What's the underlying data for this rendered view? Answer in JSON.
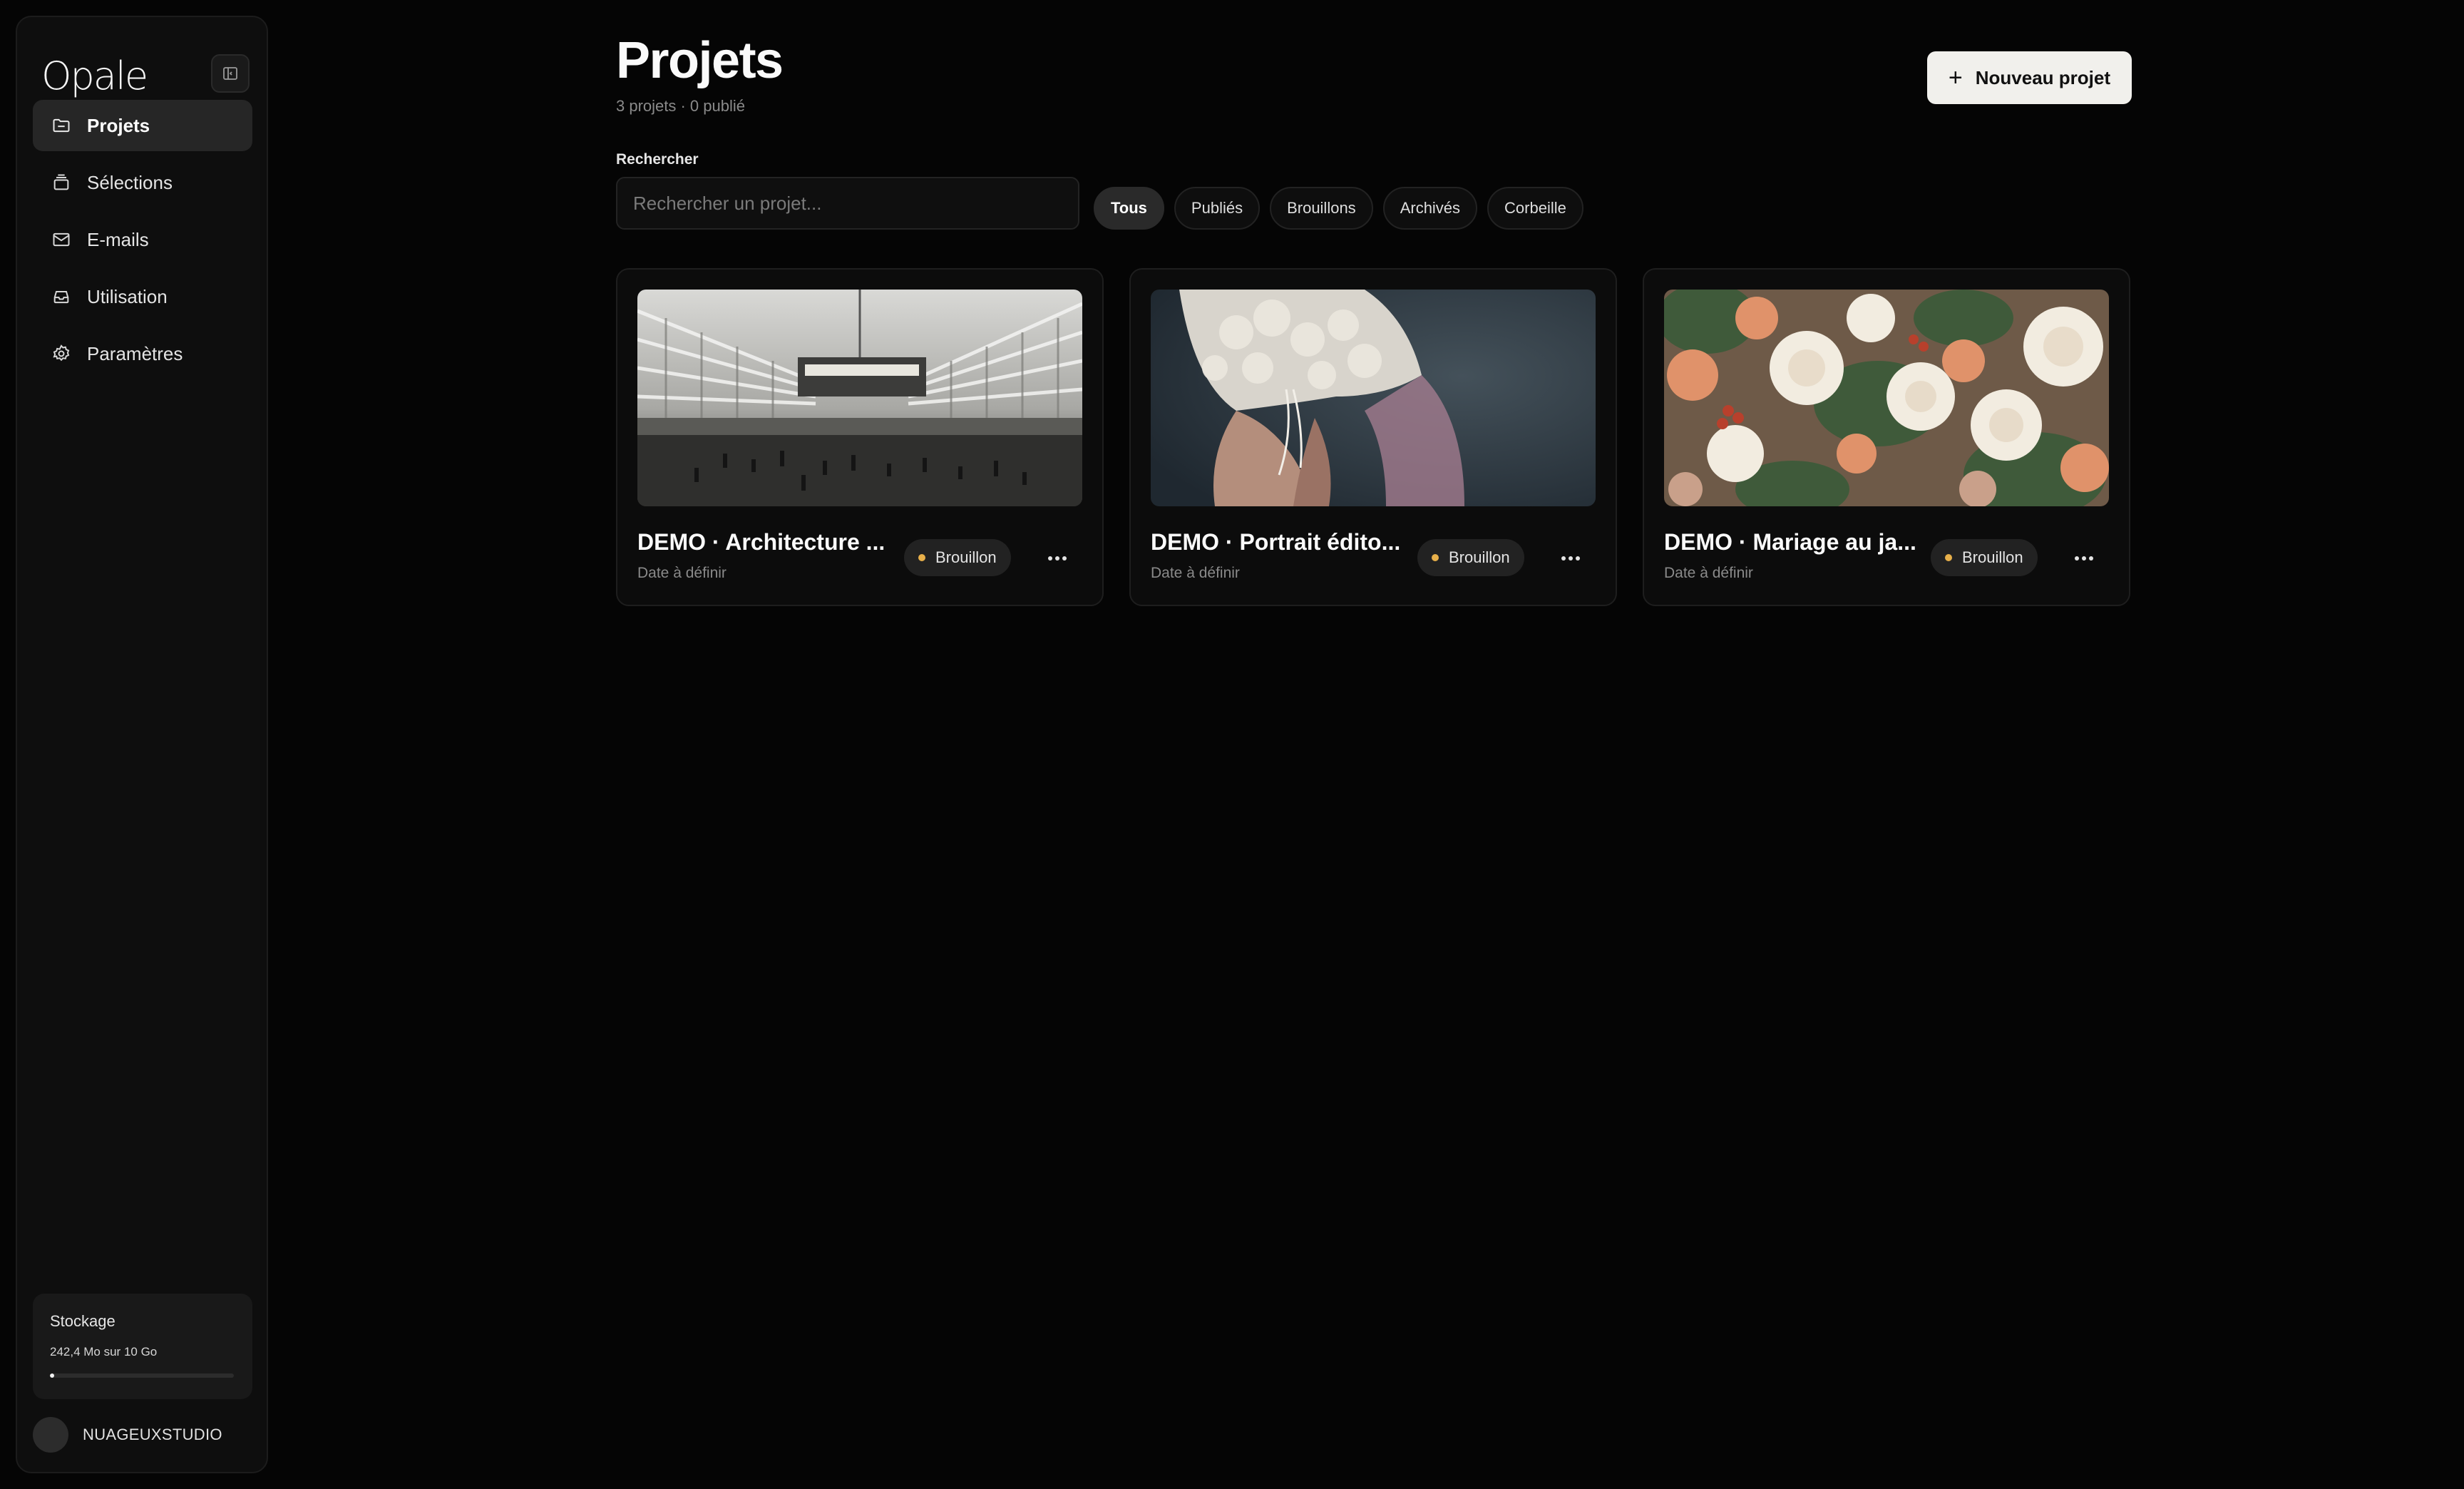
{
  "app": {
    "logo": "Opale"
  },
  "sidebar": {
    "items": [
      {
        "label": "Projets",
        "icon": "folder-icon",
        "active": true
      },
      {
        "label": "Sélections",
        "icon": "layers-icon",
        "active": false
      },
      {
        "label": "E-mails",
        "icon": "mail-icon",
        "active": false
      },
      {
        "label": "Utilisation",
        "icon": "inbox-icon",
        "active": false
      },
      {
        "label": "Paramètres",
        "icon": "gear-icon",
        "active": false
      }
    ],
    "storage": {
      "title": "Stockage",
      "value": "242,4 Mo sur 10 Go",
      "used_fraction": 0.024
    },
    "user": {
      "name": "NUAGEUXSTUDIO"
    }
  },
  "main": {
    "title": "Projets",
    "subtitle": "3 projets · 0 publié",
    "new_button": "Nouveau projet",
    "search": {
      "label": "Rechercher",
      "placeholder": "Rechercher un projet..."
    },
    "filters": [
      {
        "label": "Tous",
        "active": true
      },
      {
        "label": "Publiés",
        "active": false
      },
      {
        "label": "Brouillons",
        "active": false
      },
      {
        "label": "Archivés",
        "active": false
      },
      {
        "label": "Corbeille",
        "active": false
      }
    ],
    "projects": [
      {
        "title": "DEMO · Architecture ...",
        "date": "Date à définir",
        "status": "Brouillon",
        "status_color": "#e8b04a"
      },
      {
        "title": "DEMO · Portrait édito...",
        "date": "Date à définir",
        "status": "Brouillon",
        "status_color": "#e8b04a"
      },
      {
        "title": "DEMO · Mariage au ja...",
        "date": "Date à définir",
        "status": "Brouillon",
        "status_color": "#e8b04a"
      }
    ]
  }
}
